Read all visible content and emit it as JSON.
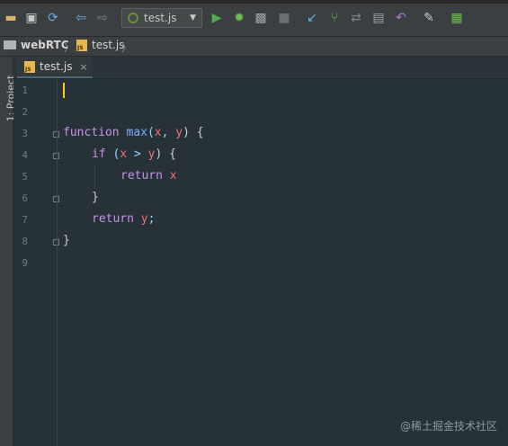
{
  "toolbar": {
    "icons": [
      "open-folder-icon",
      "save-icon",
      "sync-icon",
      "back-icon",
      "forward-icon",
      "run-icon",
      "debug-icon",
      "coverage-icon",
      "stop-icon",
      "vcs-update-icon",
      "vcs-commit-icon",
      "vcs-compare-icon",
      "vcs-history-icon",
      "revert-icon",
      "settings-icon",
      "project-structure-icon"
    ],
    "run_config": "test.js"
  },
  "breadcrumb": {
    "project": "webRTC",
    "file": "test.js"
  },
  "sidebar": {
    "project_label": "1: Project"
  },
  "tab": {
    "label": "test.js",
    "close": "×"
  },
  "editor": {
    "line_numbers": [
      "1",
      "2",
      "3",
      "4",
      "5",
      "6",
      "7",
      "8",
      "9"
    ],
    "code": {
      "l3_kw": "function",
      "l3_fn": "max",
      "l3_open": "(",
      "l3_x": "x",
      "l3_comma": ", ",
      "l3_y": "y",
      "l3_close": ") {",
      "l4_kw": "if",
      "l4_open": " (",
      "l4_x": "x",
      "l4_gt": " > ",
      "l4_y": "y",
      "l4_close": ") {",
      "l5_kw": "return",
      "l5_x": "x",
      "l6_brace": "}",
      "l7_kw": "return",
      "l7_y": "y",
      "l7_semi": ";",
      "l8_brace": "}"
    }
  },
  "watermark": "@稀土掘金技术社区",
  "colors": {
    "background": "#263238",
    "keyword": "#c792ea",
    "function": "#82aaff",
    "variable": "#f07178",
    "cursor": "#ffcc00"
  }
}
